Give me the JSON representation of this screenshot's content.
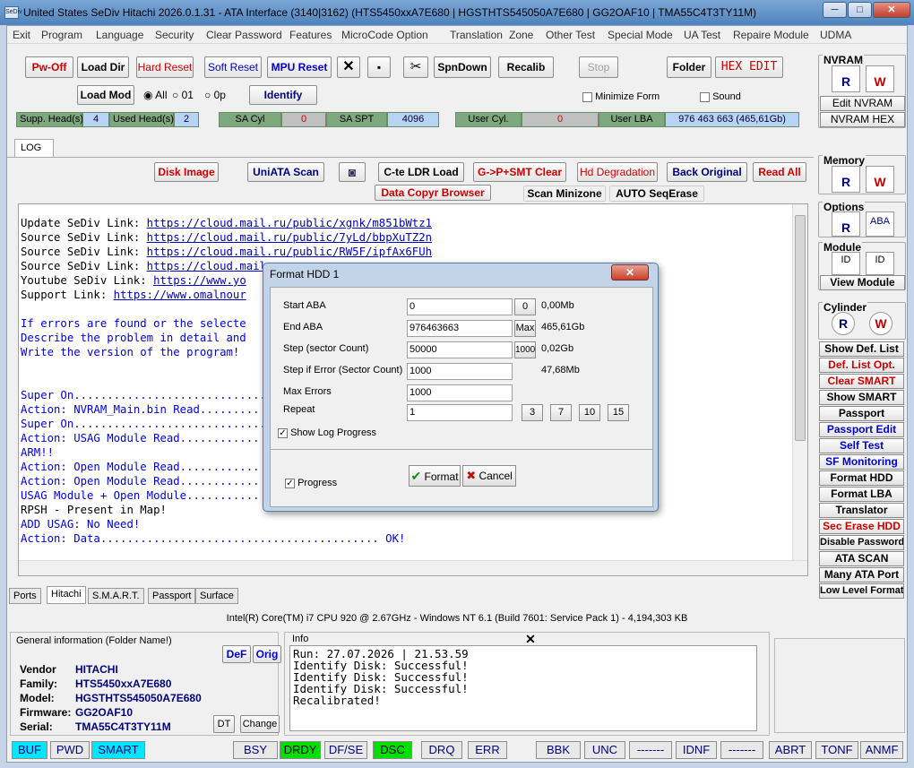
{
  "window": {
    "title": "United States  SeDiv Hitachi  2026.0.1.31 - ATA Interface  (3140|3162) (HTS5450xxA7E680 | HGSTHTS545050A7E680 | GG2OAF10 | TMA55C4T3TY11M)",
    "icon": "SeDiv",
    "min": "─",
    "max": "□",
    "close": "✕"
  },
  "menu": [
    "Exit",
    "Program",
    "Language",
    "Security",
    "Clear Password",
    "Features",
    "MicroCode Option",
    "Translation",
    "Zone",
    "Other Test",
    "Special Mode",
    "UA Test",
    "Repaire Module",
    "UDMA"
  ],
  "toolbar": {
    "pw_off": "Pw-Off",
    "load_dir": "Load Dir",
    "hard_reset": "Hard Reset",
    "soft_reset": "Soft Reset",
    "mpu_reset": "MPU Reset",
    "x": "✕",
    "save": "▪",
    "tools": "✂",
    "spndown": "SpnDown",
    "recalib": "Recalib",
    "stop": "Stop",
    "folder": "Folder",
    "hex_edit": "HEX EDIT",
    "load_mod": "Load Mod",
    "radio_all": "All",
    "radio_01": "01",
    "radio_0p": "0p",
    "identify": "Identify",
    "minimize_form": "Minimize Form",
    "sound": "Sound"
  },
  "info": {
    "supp_heads_label": "Supp. Head(s)",
    "supp_heads": "4",
    "used_heads_label": "Used Head(s)",
    "used_heads": "2",
    "sa_cyl_label": "SA Cyl",
    "sa_cyl": "0",
    "sa_spt_label": "SA SPT",
    "sa_spt": "4096",
    "user_cyl_label": "User Cyl.",
    "user_cyl": "0",
    "user_lba_label": "User LBA",
    "user_lba": "976 463 663  (465,61Gb)"
  },
  "log_tab": "LOG",
  "actions": {
    "disk_image": "Disk Image",
    "uniata": "UniATA Scan",
    "camera": "◙",
    "cte_ldr": "C-te LDR Load",
    "gpsmt": "G->P+SMT Clear",
    "hd_degr": "Hd Degradation",
    "back_orig": "Back Original",
    "read_all": "Read All",
    "data_copyr": "Data Copyr Browser",
    "scan_mini": "Scan Minizone",
    "auto_seq": "AUTO SeqErase"
  },
  "log": {
    "links": [
      {
        "label": "Update SeDiv Link: ",
        "url": "https://cloud.mail.ru/public/xgnk/m851bWtz1"
      },
      {
        "label": "Source SeDiv Link: ",
        "url": "https://cloud.mail.ru/public/7yLd/bbpXuTZ2n"
      },
      {
        "label": "Source SeDiv Link: ",
        "url": "https://cloud.mail.ru/public/RW5F/ipfAx6FUh"
      },
      {
        "label": "Source SeDiv Link: ",
        "url": "https://cloud.mail.r"
      },
      {
        "label": "Youtube SeDiv Link: ",
        "url": "https://www.yo"
      },
      {
        "label": "Support Link: ",
        "url": "https://www.omalnour"
      }
    ],
    "msg1": "If errors are found or the selecte",
    "msg2": "Describe the problem in detail and",
    "msg3": "Write the version of the program!",
    "l1": "Super On.............................",
    "l2": "Action: NVRAM_Main.bin Read.........",
    "l3": "Super On.............................",
    "l4": "Action: USAG Module Read............",
    "l5": "ARM!!",
    "l6": "Action: Open Module Read............",
    "l7": "Action: Open Module Read............",
    "l8": "USAG Module + Open Module...........",
    "l9": "RPSH - Present in Map!",
    "l10": "ADD USAG: No Need!",
    "l11": "Action: Data.......................................... OK!"
  },
  "dialog": {
    "title": "Format HDD 1",
    "close": "✕",
    "start_aba_label": "Start ABA",
    "start_aba": "0",
    "btn0": "0",
    "start_size": "0,00Mb",
    "end_aba_label": "End ABA",
    "end_aba": "976463663",
    "max": "Max",
    "end_size": "465,61Gb",
    "step_label": "Step (sector Count)",
    "step": "50000",
    "btn1000": "1000",
    "step_size": "0,02Gb",
    "step_err_label": "Step if Error (Sector Count)",
    "step_err": "1000",
    "step_err_size": "47,68Mb",
    "max_err_label": "Max Errors",
    "max_err": "1000",
    "repeat_label": "Repeat",
    "repeat": "1",
    "r3": "3",
    "r7": "7",
    "r10": "10",
    "r15": "15",
    "show_log": "Show Log Progress",
    "progress": "Progress",
    "format": "Format",
    "cancel": "Cancel",
    "check": "✓",
    "ok_mark": "✔",
    "x_mark": "✖"
  },
  "right": {
    "nvram": "NVRAM",
    "edit_nvram": "Edit NVRAM",
    "nvram_hex": "NVRAM HEX",
    "memory": "Memory",
    "options": "Options",
    "module": "Module",
    "view_module": "View Module",
    "cylinder": "Cylinder",
    "icon_r": "R",
    "icon_w": "W",
    "icon_aba": "ABA",
    "icon_id": "ID",
    "buttons": [
      {
        "t": "Show Def. List",
        "c": "#000"
      },
      {
        "t": "Def. List Opt.",
        "c": "#d00000"
      },
      {
        "t": "Clear SMART",
        "c": "#d00000"
      },
      {
        "t": "Show SMART",
        "c": "#000"
      },
      {
        "t": "Passport",
        "c": "#000"
      },
      {
        "t": "Passport Edit",
        "c": "#0000d0"
      },
      {
        "t": "Self Test",
        "c": "#0000d0"
      },
      {
        "t": "SF Monitoring",
        "c": "#0000d0"
      },
      {
        "t": "Format HDD",
        "c": "#000"
      },
      {
        "t": "Format LBA",
        "c": "#000"
      },
      {
        "t": "Translator",
        "c": "#000"
      },
      {
        "t": "Sec Erase HDD",
        "c": "#d00000"
      },
      {
        "t": "Disable Password",
        "c": "#000"
      },
      {
        "t": "ATA SCAN",
        "c": "#000"
      },
      {
        "t": "Many ATA Port",
        "c": "#000"
      },
      {
        "t": "Low Level Format",
        "c": "#000"
      }
    ]
  },
  "tabs": [
    "Ports",
    "Hitachi",
    "S.M.A.R.T.",
    "Passport",
    "Surface"
  ],
  "cpu": "Intel(R) Core(TM) i7 CPU 920  @ 2.67GHz - Windows NT 6.1 (Build 7601: Service Pack 1) - 4,194,303 KB",
  "general": {
    "title": "General information (Folder Name!)",
    "def": "DeF",
    "orig": "Orig",
    "vendor_l": "Vendor",
    "vendor": "HITACHI",
    "family_l": "Family:",
    "family": "HTS5450xxA7E680",
    "model_l": "Model:",
    "model": "HGSTHTS545050A7E680",
    "fw_l": "Firmware:",
    "fw": "GG2OAF10",
    "serial_l": "Serial:",
    "serial": "TMA55C4T3TY11M",
    "dt": "DT",
    "change": "Change"
  },
  "infopanel": {
    "title": "Info",
    "close": "✕",
    "text": "Run: 27.07.2026 | 21.53.59\nIdentify Disk: Successful!\nIdentify Disk: Successful!\nIdentify Disk: Successful!\nRecalibrated!"
  },
  "status": [
    "BUF",
    "PWD",
    "SMART",
    "BSY",
    "DRDY",
    "DF/SE",
    "DSC",
    "DRQ",
    "ERR",
    "BBK",
    "UNC",
    "-------",
    "IDNF",
    "-------",
    "ABRT",
    "TONF",
    "ANMF"
  ]
}
